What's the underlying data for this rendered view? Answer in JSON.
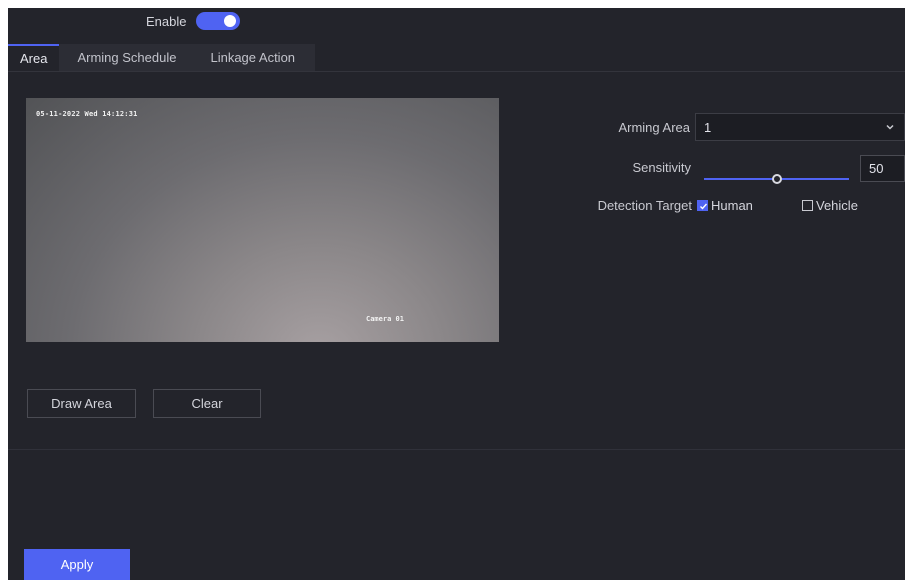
{
  "header": {
    "enable_label": "Enable",
    "enable_on": true
  },
  "tabs": [
    {
      "label": "Area",
      "active": true
    },
    {
      "label": "Arming Schedule",
      "active": false
    },
    {
      "label": "Linkage Action",
      "active": false
    }
  ],
  "preview": {
    "timestamp": "05-11-2022 Wed 14:12:31",
    "camera_name": "Camera 01"
  },
  "settings": {
    "arming_area": {
      "label": "Arming Area",
      "value": "1"
    },
    "sensitivity": {
      "label": "Sensitivity",
      "value": "50",
      "fraction": 0.5
    },
    "detection_target": {
      "label": "Detection Target",
      "options": [
        {
          "label": "Human",
          "checked": true
        },
        {
          "label": "Vehicle",
          "checked": false
        }
      ]
    }
  },
  "buttons": {
    "draw_area": "Draw Area",
    "clear": "Clear",
    "apply": "Apply"
  },
  "colors": {
    "accent": "#4f63f2",
    "panel_bg": "#23242b"
  },
  "icons": {
    "select_arrow": "chevron-down-icon",
    "checkbox_checked": "checkmark-icon"
  }
}
